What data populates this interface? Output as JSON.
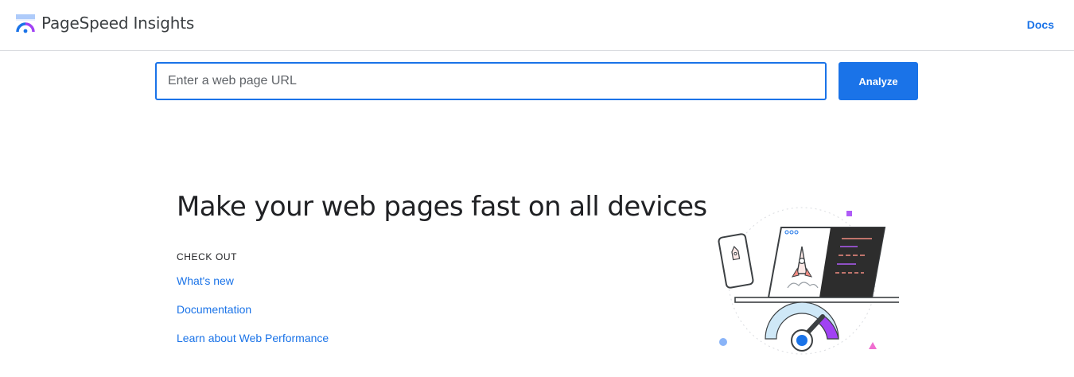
{
  "header": {
    "app_title": "PageSpeed Insights",
    "docs_label": "Docs",
    "logo_icon": "pagespeed-gauge-icon"
  },
  "search": {
    "placeholder": "Enter a web page URL",
    "value": "",
    "analyze_label": "Analyze"
  },
  "hero": {
    "headline": "Make your web pages fast on all devices",
    "check_out_label": "CHECK OUT",
    "links": [
      {
        "label": "What's new"
      },
      {
        "label": "Documentation"
      },
      {
        "label": "Learn about Web Performance"
      }
    ],
    "illustration_icon": "devices-speed-gauge-illustration"
  },
  "colors": {
    "accent": "#1a73e8",
    "text": "#202124",
    "divider": "#dadce0",
    "gauge_purple": "#a142f4",
    "gauge_light_blue": "#cfe8f7",
    "code_panel": "#2d2d2d",
    "code_red": "#f28b82",
    "code_violet": "#af5cf7"
  }
}
